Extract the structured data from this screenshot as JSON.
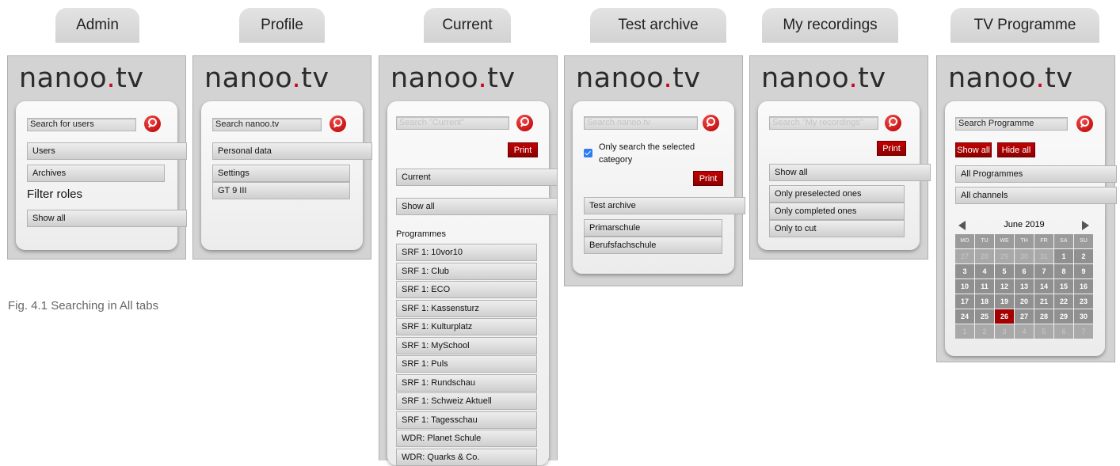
{
  "tabs": [
    {
      "label": "Admin"
    },
    {
      "label": "Profile"
    },
    {
      "label": "Current"
    },
    {
      "label": "Test archive"
    },
    {
      "label": "My recordings"
    },
    {
      "label": "TV Programme"
    }
  ],
  "brand": {
    "text_a": "nanoo",
    "dot": ".",
    "text_b": "tv",
    "accent": "#d0021b"
  },
  "admin": {
    "search_placeholder": "Search for users",
    "items": [
      "Users",
      "Archives"
    ],
    "heading": "Filter roles",
    "filter": "Show all"
  },
  "profile": {
    "search_placeholder": "Search nanoo.tv",
    "items": [
      "Personal data",
      "Settings",
      "GT 9 III"
    ]
  },
  "current": {
    "search_placeholder": "Search \"Current\"",
    "print": "Print",
    "category": "Current",
    "filter": "Show all",
    "programmes_label": "Programmes",
    "programmes": [
      "SRF 1: 10vor10",
      "SRF 1: Club",
      "SRF 1: ECO",
      "SRF 1: Kassensturz",
      "SRF 1: Kulturplatz",
      "SRF 1: MySchool",
      "SRF 1: Puls",
      "SRF 1: Rundschau",
      "SRF 1: Schweiz Aktuell",
      "SRF 1: Tagesschau",
      "WDR: Planet Schule",
      "WDR: Quarks & Co."
    ]
  },
  "archive": {
    "search_placeholder": "Search nanoo.tv",
    "checkbox_label_1": "Only search the selected",
    "checkbox_label_2": "category",
    "print": "Print",
    "items": [
      "Test archive",
      "Primarschule",
      "Berufsfachschule"
    ]
  },
  "recordings": {
    "search_placeholder": "Search \"My recordings\"",
    "print": "Print",
    "filters": [
      "Show all",
      "Only preselected ones",
      "Only completed ones",
      "Only to cut"
    ]
  },
  "tvprog": {
    "search_value": "Search Programme",
    "show_all": "Show all",
    "hide_all": "Hide all",
    "filters": [
      "All Programmes",
      "All channels"
    ],
    "calendar": {
      "month": "June 2019",
      "days": [
        "MO",
        "TU",
        "WE",
        "TH",
        "FR",
        "SA",
        "SU"
      ],
      "cells": [
        "27",
        "28",
        "29",
        "30",
        "31",
        "1",
        "2",
        "3",
        "4",
        "5",
        "6",
        "7",
        "8",
        "9",
        "10",
        "11",
        "12",
        "13",
        "14",
        "15",
        "16",
        "17",
        "18",
        "19",
        "20",
        "21",
        "22",
        "23",
        "24",
        "25",
        "26",
        "27",
        "28",
        "29",
        "30",
        "1",
        "2",
        "3",
        "4",
        "5",
        "6",
        "7"
      ],
      "selected": "26"
    }
  },
  "caption": "Fig. 4.1 Searching in All tabs"
}
